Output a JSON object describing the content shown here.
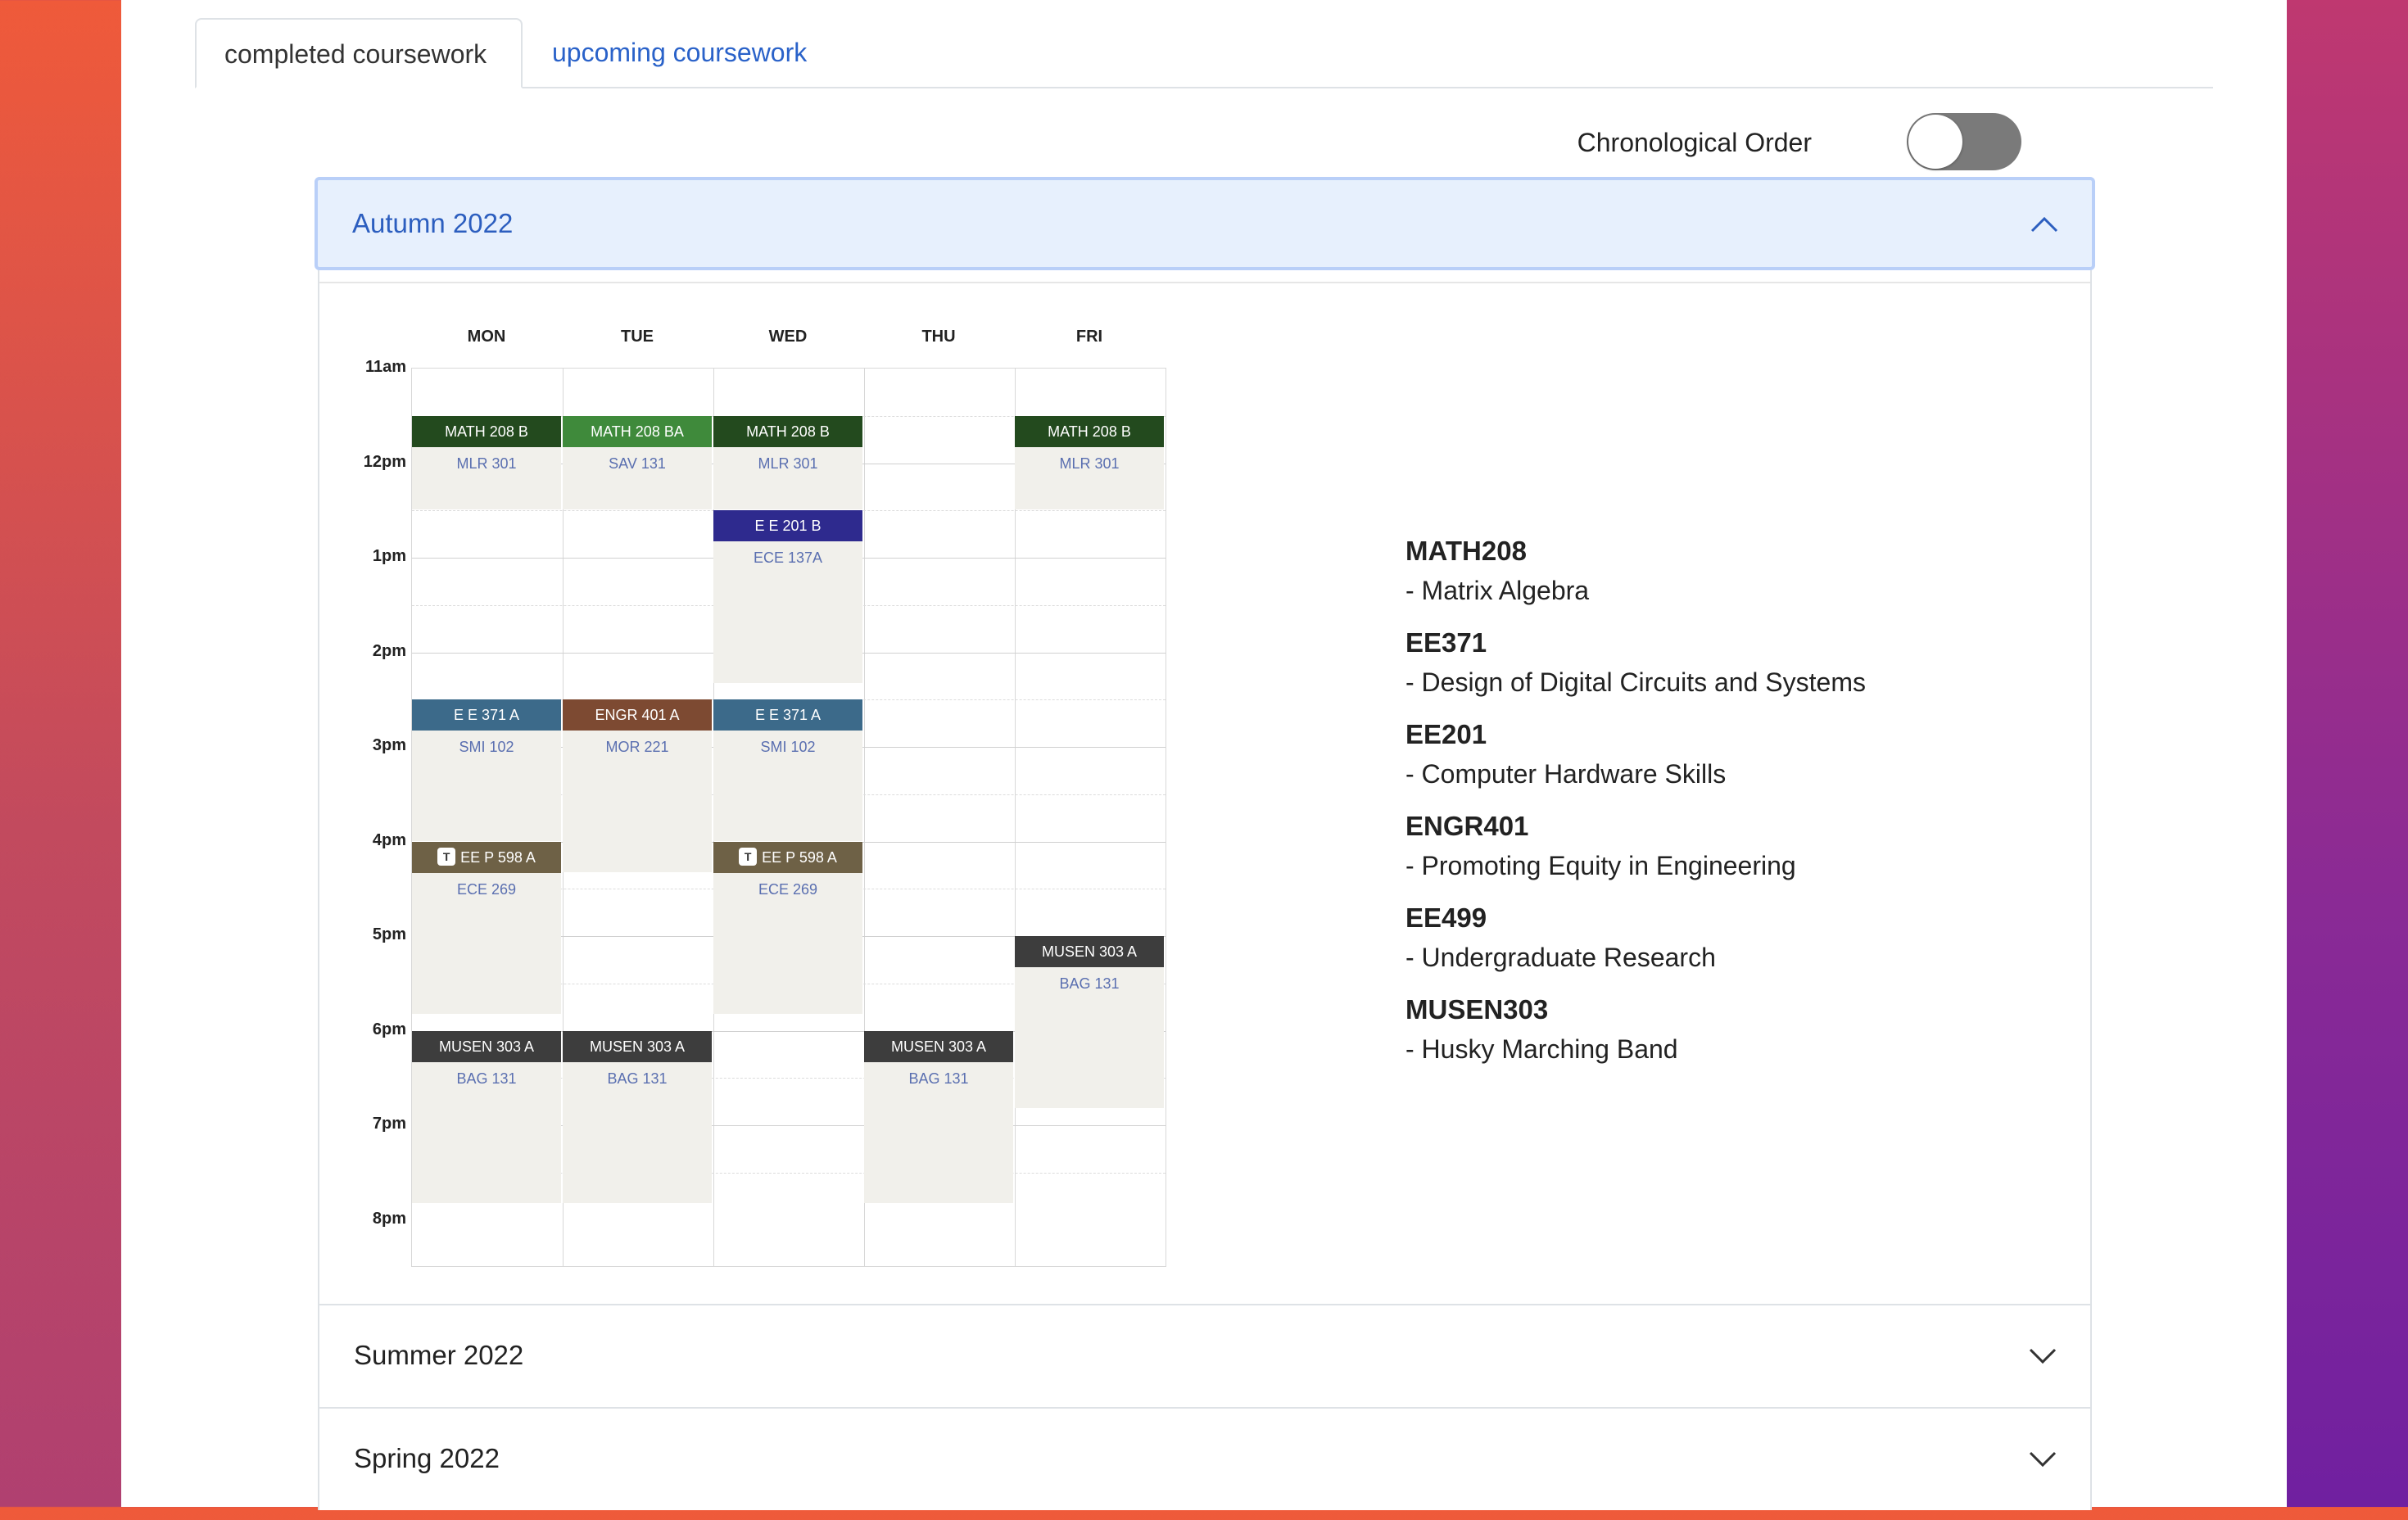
{
  "tabs": [
    {
      "label": "completed coursework",
      "active": true
    },
    {
      "label": "upcoming coursework",
      "active": false
    }
  ],
  "toggle": {
    "label": "Chronological Order",
    "on": false
  },
  "terms": {
    "active": {
      "label": "Autumn 2022",
      "expanded": true
    },
    "collapsed": [
      {
        "label": "Summer 2022"
      },
      {
        "label": "Spring 2022"
      }
    ]
  },
  "schedule": {
    "days": [
      "MON",
      "TUE",
      "WED",
      "THU",
      "FRI"
    ],
    "times": [
      "11am",
      "12pm",
      "1pm",
      "2pm",
      "3pm",
      "4pm",
      "5pm",
      "6pm",
      "7pm",
      "8pm"
    ],
    "events": [
      {
        "title": "MATH 208 B",
        "location": "MLR 301",
        "color": "#234a1e",
        "day": 0,
        "start": 11.5,
        "end": 12.5,
        "tag": ""
      },
      {
        "title": "MATH 208 BA",
        "location": "SAV 131",
        "color": "#3f8a3b",
        "day": 1,
        "start": 11.5,
        "end": 12.5,
        "tag": ""
      },
      {
        "title": "MATH 208 B",
        "location": "MLR 301",
        "color": "#234a1e",
        "day": 2,
        "start": 11.5,
        "end": 12.5,
        "tag": ""
      },
      {
        "title": "MATH 208 B",
        "location": "MLR 301",
        "color": "#234a1e",
        "day": 4,
        "start": 11.5,
        "end": 12.5,
        "tag": ""
      },
      {
        "title": "E E 201 B",
        "location": "ECE 137A",
        "color": "#2e2a8e",
        "day": 2,
        "start": 12.5,
        "end": 14.33,
        "tag": ""
      },
      {
        "title": "E E 371 A",
        "location": "SMI 102",
        "color": "#3c6a8a",
        "day": 0,
        "start": 14.5,
        "end": 16.0,
        "tag": ""
      },
      {
        "title": "ENGR 401 A",
        "location": "MOR 221",
        "color": "#7d4a32",
        "day": 1,
        "start": 14.5,
        "end": 16.33,
        "tag": ""
      },
      {
        "title": "E E 371 A",
        "location": "SMI 102",
        "color": "#3c6a8a",
        "day": 2,
        "start": 14.5,
        "end": 16.0,
        "tag": ""
      },
      {
        "title": "EE P 598 A",
        "location": "ECE 269",
        "color": "#6e6146",
        "day": 0,
        "start": 16.0,
        "end": 17.83,
        "tag": "T"
      },
      {
        "title": "EE P 598 A",
        "location": "ECE 269",
        "color": "#6e6146",
        "day": 2,
        "start": 16.0,
        "end": 17.83,
        "tag": "T"
      },
      {
        "title": "MUSEN 303 A",
        "location": "BAG 131",
        "color": "#3d3d3d",
        "day": 4,
        "start": 17.0,
        "end": 18.83,
        "tag": ""
      },
      {
        "title": "MUSEN 303 A",
        "location": "BAG 131",
        "color": "#3d3d3d",
        "day": 0,
        "start": 18.0,
        "end": 19.83,
        "tag": ""
      },
      {
        "title": "MUSEN 303 A",
        "location": "BAG 131",
        "color": "#3d3d3d",
        "day": 1,
        "start": 18.0,
        "end": 19.83,
        "tag": ""
      },
      {
        "title": "MUSEN 303 A",
        "location": "BAG 131",
        "color": "#3d3d3d",
        "day": 3,
        "start": 18.0,
        "end": 19.83,
        "tag": ""
      }
    ]
  },
  "courses": [
    {
      "code": "MATH208",
      "name": "- Matrix Algebra"
    },
    {
      "code": "EE371",
      "name": "- Design of Digital Circuits and Systems"
    },
    {
      "code": "EE201",
      "name": "- Computer Hardware Skills"
    },
    {
      "code": "ENGR401",
      "name": "- Promoting Equity in Engineering"
    },
    {
      "code": "EE499",
      "name": "- Undergraduate Research"
    },
    {
      "code": "MUSEN303",
      "name": "- Husky Marching Band"
    }
  ]
}
